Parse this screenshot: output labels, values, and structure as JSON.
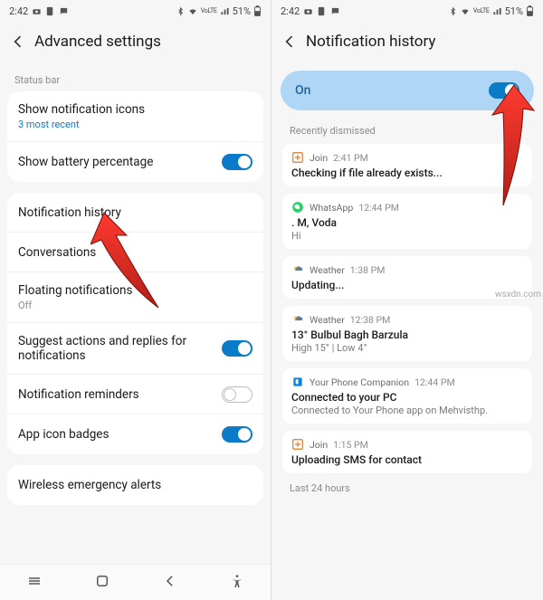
{
  "watermark": "wsxdn.com",
  "status": {
    "time": "2:42",
    "battery": "51%",
    "lte": "VoLTE",
    "signal": "▮▮◢"
  },
  "left": {
    "title": "Advanced settings",
    "status_bar_label": "Status bar",
    "rows": {
      "show_icons": {
        "title": "Show notification icons",
        "sub": "3 most recent"
      },
      "battery_pct": {
        "title": "Show battery percentage"
      },
      "notif_history": {
        "title": "Notification history"
      },
      "conversations": {
        "title": "Conversations"
      },
      "floating": {
        "title": "Floating notifications",
        "sub": "Off"
      },
      "suggest": {
        "title": "Suggest actions and replies for notifications"
      },
      "reminders": {
        "title": "Notification reminders"
      },
      "badges": {
        "title": "App icon badges"
      },
      "emergency": {
        "title": "Wireless emergency alerts"
      }
    }
  },
  "right": {
    "title": "Notification history",
    "on_label": "On",
    "recent_label": "Recently dismissed",
    "last24_label": "Last 24 hours",
    "notifs": [
      {
        "app": "Join",
        "time": "2:41 PM",
        "title": "Checking if file already exists...",
        "body": "",
        "icon": "join"
      },
      {
        "app": "WhatsApp",
        "time": "12:44 PM",
        "title": ". M, Voda",
        "body": "Hi",
        "icon": "whatsapp"
      },
      {
        "app": "Weather",
        "time": "1:38 PM",
        "title": "Updating...",
        "body": "",
        "icon": "weather"
      },
      {
        "app": "Weather",
        "time": "12:38 PM",
        "title": "13° Bulbul Bagh Barzula",
        "body": "High 15° | Low 4°",
        "icon": "weather"
      },
      {
        "app": "Your Phone Companion",
        "time": "12:44 PM",
        "title": "Connected to your PC",
        "body": "Connected to Your Phone app on Mehvisthp.",
        "icon": "phone"
      },
      {
        "app": "Join",
        "time": "1:15 PM",
        "title": "Uploading SMS for contact",
        "body": "",
        "icon": "join"
      }
    ]
  }
}
